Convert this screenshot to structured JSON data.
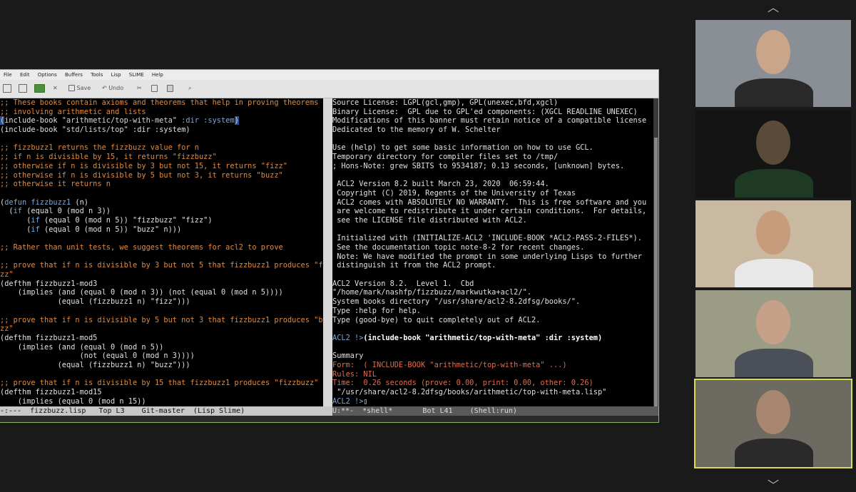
{
  "menu": [
    "File",
    "Edit",
    "Options",
    "Buffers",
    "Tools",
    "Lisp",
    "SLIME",
    "Help"
  ],
  "toolbar": {
    "save_label": "Save",
    "undo_label": "Undo"
  },
  "left_buffer": {
    "lines": [
      [
        {
          "t": ";; These books contain axioms and theorems that help in proving theorems",
          "c": "c"
        }
      ],
      [
        {
          "t": ";; involving arithmetic and lists",
          "c": "c"
        }
      ],
      [
        {
          "t": "(",
          "c": "w",
          "hl": true
        },
        {
          "t": "include-book ",
          "c": "w"
        },
        {
          "t": "\"arithmetic/top-with-meta\"",
          "c": "s"
        },
        {
          "t": " :dir :system",
          "c": "k"
        },
        {
          "t": ")",
          "c": "w",
          "hl": true
        }
      ],
      [
        {
          "t": "(include-book ",
          "c": "w"
        },
        {
          "t": "\"std/lists/top\"",
          "c": "s"
        },
        {
          "t": " :dir :system)",
          "c": "w"
        }
      ],
      [
        {
          "t": "",
          "c": "w"
        }
      ],
      [
        {
          "t": ";; fizzbuzz1 returns the fizzbuzz value for n",
          "c": "c"
        }
      ],
      [
        {
          "t": ";; if n is divisible by 15, it returns \"fizzbuzz\"",
          "c": "c"
        }
      ],
      [
        {
          "t": ";; otherwise if n is divisible by 3 but not 15, it returns \"fizz\"",
          "c": "c"
        }
      ],
      [
        {
          "t": ";; otherwise if n is divisible by 5 but not 3, it returns \"buzz\"",
          "c": "c"
        }
      ],
      [
        {
          "t": ";; otherwise it returns n",
          "c": "c"
        }
      ],
      [
        {
          "t": "",
          "c": "w"
        }
      ],
      [
        {
          "t": "(",
          "c": "w"
        },
        {
          "t": "defun",
          "c": "k"
        },
        {
          "t": " ",
          "c": "w"
        },
        {
          "t": "fizzbuzz1",
          "c": "f"
        },
        {
          "t": " (n)",
          "c": "w"
        }
      ],
      [
        {
          "t": "  (",
          "c": "w"
        },
        {
          "t": "if",
          "c": "k"
        },
        {
          "t": " (equal 0 (mod n 3))",
          "c": "w"
        }
      ],
      [
        {
          "t": "      (",
          "c": "w"
        },
        {
          "t": "if",
          "c": "k"
        },
        {
          "t": " (equal 0 (mod n 5)) \"fizzbuzz\" \"fizz\")",
          "c": "w"
        }
      ],
      [
        {
          "t": "      (",
          "c": "w"
        },
        {
          "t": "if",
          "c": "k"
        },
        {
          "t": " (equal 0 (mod n 5)) \"buzz\" n)))",
          "c": "w"
        }
      ],
      [
        {
          "t": "",
          "c": "w"
        }
      ],
      [
        {
          "t": ";; Rather than unit tests, we suggest theorems for acl2 to prove",
          "c": "c"
        }
      ],
      [
        {
          "t": "",
          "c": "w"
        }
      ],
      [
        {
          "t": ";; prove that if n is divisible by 3 but not 5 that fizzbuzz1 produces \"fi",
          "c": "c"
        }
      ],
      [
        {
          "t": "zz\"",
          "c": "c"
        }
      ],
      [
        {
          "t": "(defthm fizzbuzz1-mod3",
          "c": "w"
        }
      ],
      [
        {
          "t": "    (implies (and (equal 0 (mod n 3)) (not (equal 0 (mod n 5))))",
          "c": "w"
        }
      ],
      [
        {
          "t": "             (equal (fizzbuzz1 n) \"fizz\")))",
          "c": "w"
        }
      ],
      [
        {
          "t": "",
          "c": "w"
        }
      ],
      [
        {
          "t": ";; prove that if n is divisible by 5 but not 3 that fizzbuzz1 produces \"bu",
          "c": "c"
        }
      ],
      [
        {
          "t": "zz\"",
          "c": "c"
        }
      ],
      [
        {
          "t": "(defthm fizzbuzz1-mod5",
          "c": "w"
        }
      ],
      [
        {
          "t": "    (implies (and (equal 0 (mod n 5))",
          "c": "w"
        }
      ],
      [
        {
          "t": "                  (not (equal 0 (mod n 3))))",
          "c": "w"
        }
      ],
      [
        {
          "t": "             (equal (fizzbuzz1 n) \"buzz\")))",
          "c": "w"
        }
      ],
      [
        {
          "t": "",
          "c": "w"
        }
      ],
      [
        {
          "t": ";; prove that if n is divisible by 15 that fizzbuzz1 produces \"fizzbuzz\"",
          "c": "c"
        }
      ],
      [
        {
          "t": "(defthm fizzbuzz1-mod15",
          "c": "w"
        }
      ],
      [
        {
          "t": "    (implies (equal 0 (mod n 15))",
          "c": "w"
        }
      ]
    ]
  },
  "right_buffer": {
    "lines": [
      [
        {
          "t": "Source License: LGPL(gcl,gmp), GPL(unexec,bfd,xgcl)",
          "c": "w"
        }
      ],
      [
        {
          "t": "Binary License:  GPL due to GPL'ed components: (XGCL READLINE UNEXEC)",
          "c": "w"
        }
      ],
      [
        {
          "t": "Modifications of this banner must retain notice of a compatible license",
          "c": "w"
        }
      ],
      [
        {
          "t": "Dedicated to the memory of W. Schelter",
          "c": "w"
        }
      ],
      [
        {
          "t": "",
          "c": "w"
        }
      ],
      [
        {
          "t": "Use (help) to get some basic information on how to use GCL.",
          "c": "w"
        }
      ],
      [
        {
          "t": "Temporary directory for compiler files set to /tmp/",
          "c": "w"
        }
      ],
      [
        {
          "t": "; Hons-Note: grew SBITS to 9534187; 0.13 seconds, [unknown] bytes.",
          "c": "w"
        }
      ],
      [
        {
          "t": "",
          "c": "w"
        }
      ],
      [
        {
          "t": " ACL2 Version 8.2 built March 23, 2020  06:59:44.",
          "c": "w"
        }
      ],
      [
        {
          "t": " Copyright (C) 2019, Regents of the University of Texas",
          "c": "w"
        }
      ],
      [
        {
          "t": " ACL2 comes with ABSOLUTELY NO WARRANTY.  This is free software and you",
          "c": "w"
        }
      ],
      [
        {
          "t": " are welcome to redistribute it under certain conditions.  For details,",
          "c": "w"
        }
      ],
      [
        {
          "t": " see the LICENSE file distributed with ACL2.",
          "c": "w"
        }
      ],
      [
        {
          "t": "",
          "c": "w"
        }
      ],
      [
        {
          "t": " Initialized with (INITIALIZE-ACL2 'INCLUDE-BOOK *ACL2-PASS-2-FILES*).",
          "c": "w"
        }
      ],
      [
        {
          "t": " See the documentation topic note-8-2 for recent changes.",
          "c": "w"
        }
      ],
      [
        {
          "t": " Note: We have modified the prompt in some underlying Lisps to further",
          "c": "w"
        }
      ],
      [
        {
          "t": " distinguish it from the ACL2 prompt.",
          "c": "w"
        }
      ],
      [
        {
          "t": "",
          "c": "w"
        }
      ],
      [
        {
          "t": "ACL2 Version 8.2.  Level 1.  Cbd",
          "c": "w"
        }
      ],
      [
        {
          "t": "\"/home/mark/nashfp/fizzbuzz/markwutka+acl2/\".",
          "c": "w"
        }
      ],
      [
        {
          "t": "System books directory \"/usr/share/acl2-8.2dfsg/books/\".",
          "c": "w"
        }
      ],
      [
        {
          "t": "Type :help for help.",
          "c": "w"
        }
      ],
      [
        {
          "t": "Type (good-bye) to quit completely out of ACL2.",
          "c": "w"
        }
      ],
      [
        {
          "t": "",
          "c": "w"
        }
      ],
      [
        {
          "t": "ACL2 !>",
          "c": "k"
        },
        {
          "t": "(include-book \"arithmetic/top-with-meta\" :dir :system)",
          "c": "b"
        }
      ],
      [
        {
          "t": "",
          "c": "w"
        }
      ],
      [
        {
          "t": "Summary",
          "c": "w"
        }
      ],
      [
        {
          "t": "Form:  ( INCLUDE-BOOK \"arithmetic/top-with-meta\" ...)",
          "c": "r"
        }
      ],
      [
        {
          "t": "Rules: NIL",
          "c": "r"
        }
      ],
      [
        {
          "t": "Time:  0.26 seconds (prove: 0.00, print: 0.00, other: 0.26)",
          "c": "r"
        }
      ],
      [
        {
          "t": " \"/usr/share/acl2-8.2dfsg/books/arithmetic/top-with-meta.lisp\"",
          "c": "w"
        }
      ],
      [
        {
          "t": "ACL2 !>",
          "c": "k"
        },
        {
          "t": "▯",
          "c": "w"
        }
      ]
    ]
  },
  "modeline_left": "-:---  fizzbuzz.lisp   Top L3    Git-master  (Lisp Slime)",
  "modeline_right": "U:**-  *shell*       Bot L41    (Shell:run)",
  "participants": [
    {
      "bg": "#8a8f96",
      "skin": "#c9a58a",
      "shirt": "#2a2a2a"
    },
    {
      "bg": "#141414",
      "skin": "#5a4a3a",
      "shirt": "#1e3a22"
    },
    {
      "bg": "#c8b9a0",
      "skin": "#c79c7a",
      "shirt": "#e8e8e8"
    },
    {
      "bg": "#9a9c86",
      "skin": "#c6a088",
      "shirt": "#4a4f58"
    },
    {
      "bg": "#6d6a62",
      "skin": "#a88670",
      "shirt": "#2a2a2a"
    }
  ]
}
